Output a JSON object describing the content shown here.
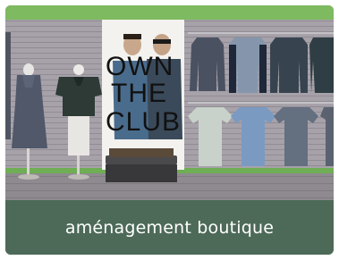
{
  "card": {
    "caption": "aménagement boutique",
    "background": "#4d6a58"
  },
  "photo": {
    "poster": {
      "line1": "OWN",
      "line2": "THE",
      "line3": "CLUB"
    },
    "colors": {
      "wall": "#a5a0a8",
      "floor": "#9a969a",
      "top_border": "#7dba60",
      "bench": "#3e3e40"
    }
  }
}
